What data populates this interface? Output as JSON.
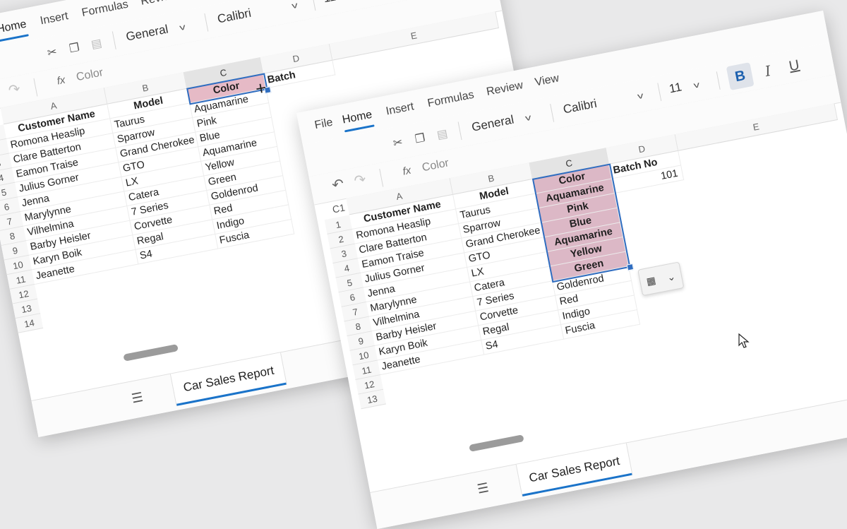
{
  "menu": [
    "File",
    "Home",
    "Insert",
    "Formulas",
    "Review",
    "View"
  ],
  "toolbar": {
    "number_format": "General",
    "font_name": "Calibri",
    "font_size": "11",
    "bold": "B",
    "italic": "I",
    "underline": "U"
  },
  "formula_bar": {
    "name_box": "C1",
    "fx": "fx",
    "value": "Color"
  },
  "columns": [
    "A",
    "B",
    "C",
    "D",
    "E"
  ],
  "rows": [
    "1",
    "2",
    "3",
    "4",
    "5",
    "6",
    "7",
    "8",
    "9",
    "10",
    "11",
    "12",
    "13",
    "14"
  ],
  "headers": {
    "customer": "Customer Name",
    "model": "Model",
    "color": "Color",
    "batch": "Batch No",
    "batch_short": "Batch"
  },
  "customers": [
    "Romona Heaslip",
    "Clare Batterton",
    "Eamon Traise",
    "Julius Gorner",
    "Jenna",
    "Marylynne",
    "Vilhelmina",
    "Barby Heisler",
    "Karyn Boik",
    "Jeanette"
  ],
  "models": [
    "Taurus",
    "Sparrow",
    "Grand Cherokee",
    "GTO",
    "LX",
    "Catera",
    "7 Series",
    "Corvette",
    "Regal",
    "S4"
  ],
  "colors": [
    "Aquamarine",
    "Pink",
    "Blue",
    "Aquamarine",
    "Yellow",
    "Green",
    "Goldenrod",
    "Red",
    "Indigo",
    "Fuscia"
  ],
  "batch_value": "101",
  "sheet_tab": "Car Sales Report",
  "selection_color": "#2f6dc0",
  "highlight_color": "#dcb8c6"
}
